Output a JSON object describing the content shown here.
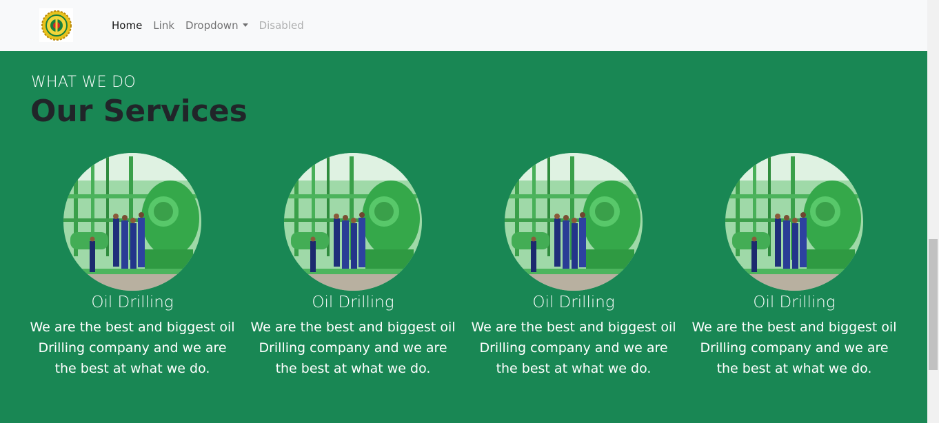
{
  "navbar": {
    "logo": {
      "icon": "logo-emblem-icon"
    },
    "links": [
      {
        "label": "Home",
        "state": "active"
      },
      {
        "label": "Link",
        "state": "normal"
      },
      {
        "label": "Dropdown",
        "state": "dropdown"
      },
      {
        "label": "Disabled",
        "state": "disabled"
      }
    ]
  },
  "services": {
    "eyebrow": "WHAT WE DO",
    "title": "Our Services",
    "cards": [
      {
        "title": "Oil Drilling",
        "text": "We are the best and biggest oil Drilling company and we are the best at what we do."
      },
      {
        "title": "Oil Drilling",
        "text": "We are the best and biggest oil Drilling company and we are the best at what we do."
      },
      {
        "title": "Oil Drilling",
        "text": "We are the best and biggest oil Drilling company and we are the best at what we do."
      },
      {
        "title": "Oil Drilling",
        "text": "We are the best and biggest oil Drilling company and we are the best at what we do."
      }
    ]
  },
  "colors": {
    "section_bg": "#198754",
    "navbar_bg": "#f8f9fa",
    "title_color": "#212529"
  }
}
